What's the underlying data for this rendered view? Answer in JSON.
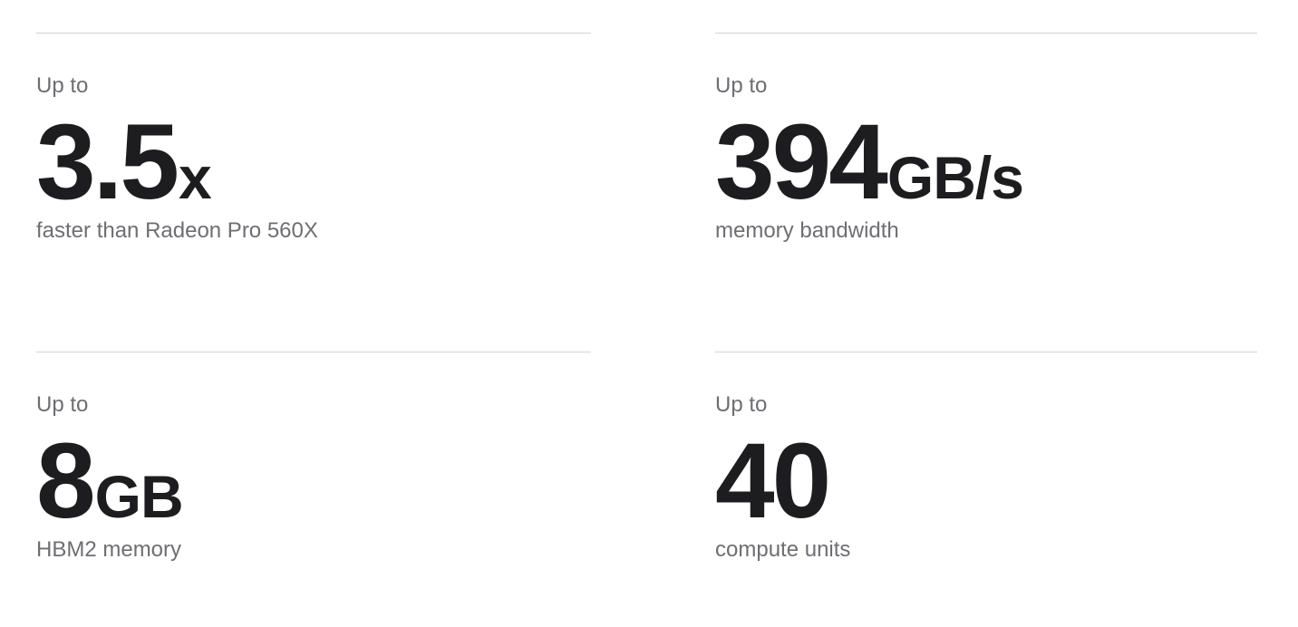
{
  "stats": [
    {
      "lead": "Up to",
      "number": "3.5",
      "unit": "x",
      "caption": "faster than Radeon Pro 560X"
    },
    {
      "lead": "Up to",
      "number": "394",
      "unit": "GB/s",
      "caption": "memory bandwidth"
    },
    {
      "lead": "Up to",
      "number": "8",
      "unit": "GB",
      "caption": "HBM2 memory"
    },
    {
      "lead": "Up to",
      "number": "40",
      "unit": "",
      "caption": "compute units"
    }
  ]
}
